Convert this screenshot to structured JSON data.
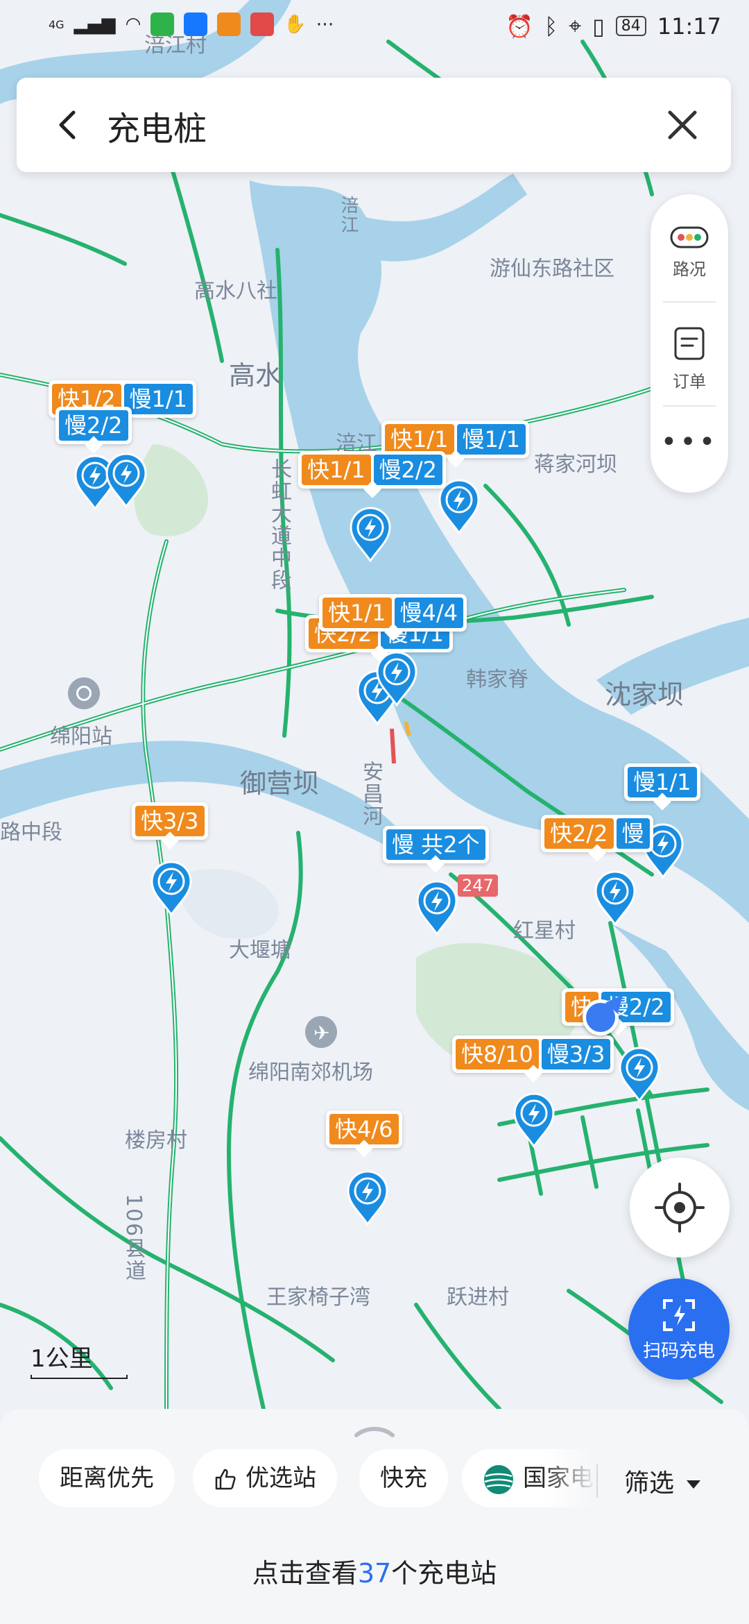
{
  "status_bar": {
    "network": "4G",
    "battery": "84",
    "time": "11:17"
  },
  "search": {
    "query": "充电桩"
  },
  "tools": {
    "traffic": "路况",
    "orders": "订单"
  },
  "places": {
    "haijiang": "涪江村",
    "gaoshui_ba": "高水八社",
    "gaoshui": "高水",
    "youxian": "游仙东路社区",
    "jiangjia": "蒋家河坝",
    "fujiang_top": "涪江",
    "fujiang_mid": "涪江",
    "changhong": "长虹大道中段",
    "hanjiaji": "韩家脊",
    "shenjiaba": "沈家坝",
    "mianyang_st": "绵阳站",
    "yuyingba": "御营坝",
    "anchang": "安昌河",
    "dayantang": "大堰塘",
    "hongxing": "红星村",
    "airport": "绵阳南郊机场",
    "loufang": "楼房村",
    "wangjia": "王家椅子湾",
    "yuejin": "跃进村",
    "county_road": "106县道",
    "road_left": "路中段",
    "road_tag": "247"
  },
  "stations": [
    {
      "fast": "快1/2",
      "slow": "慢1/1"
    },
    {
      "fast": "",
      "slow": "慢2/2"
    },
    {
      "fast": "快1/1",
      "slow": "慢1/1"
    },
    {
      "fast": "快1/1",
      "slow": "慢2/2"
    },
    {
      "fast": "快2/2",
      "slow": "慢1/1"
    },
    {
      "fast": "快1/1",
      "slow": "慢4/4"
    },
    {
      "fast": "快3/3",
      "slow": ""
    },
    {
      "fast": "",
      "slow": "慢 共2个"
    },
    {
      "fast": "",
      "slow": "慢1/1"
    },
    {
      "fast": "快2/2",
      "slow": "慢"
    },
    {
      "fast": "快",
      "slow": "慢2/2"
    },
    {
      "fast": "快8/10",
      "slow": "慢3/3"
    },
    {
      "fast": "快4/6",
      "slow": ""
    }
  ],
  "scale": "1公里",
  "scan_button": "扫码充电",
  "filters": {
    "distance": "距离优先",
    "preferred": "优选站",
    "fast": "快充",
    "state_grid": "国家电"
  },
  "filter_button": "筛选",
  "summary": {
    "prefix": "点击查看",
    "count": "37",
    "suffix": "个充电站"
  },
  "colors": {
    "road": "#25b26e",
    "water": "#9fcde8",
    "green_area": "#cfe7d3",
    "accent": "#2a6ff0",
    "fast": "#f08a1d",
    "slow": "#1a8de0"
  }
}
